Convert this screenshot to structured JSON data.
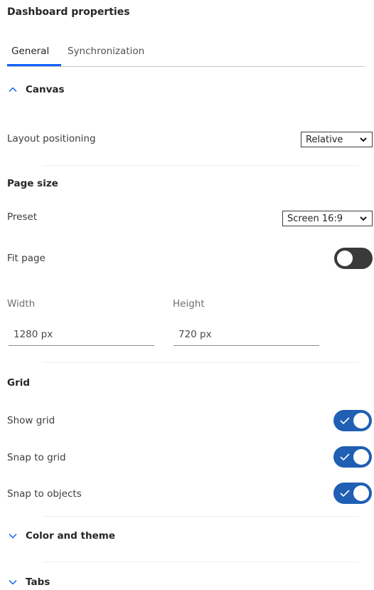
{
  "title": "Dashboard properties",
  "tabs": [
    {
      "label": "General",
      "active": true
    },
    {
      "label": "Synchronization",
      "active": false
    }
  ],
  "canvas": {
    "label": "Canvas",
    "expanded": true,
    "layout_positioning": {
      "label": "Layout positioning",
      "value": "Relative"
    },
    "page_size": {
      "heading": "Page size",
      "preset": {
        "label": "Preset",
        "value": "Screen 16:9"
      },
      "fit_page": {
        "label": "Fit page",
        "on": false
      },
      "width": {
        "label": "Width",
        "value": "1280 px"
      },
      "height": {
        "label": "Height",
        "value": "720 px"
      }
    },
    "grid": {
      "heading": "Grid",
      "show_grid": {
        "label": "Show grid",
        "on": true
      },
      "snap_to_grid": {
        "label": "Snap to grid",
        "on": true
      },
      "snap_to_objects": {
        "label": "Snap to objects",
        "on": true
      }
    }
  },
  "color_and_theme": {
    "label": "Color and theme",
    "expanded": false
  },
  "tabs_section": {
    "label": "Tabs",
    "expanded": false
  },
  "colors": {
    "accent": "#0f62fe",
    "toggle_on": "#1f5fb4",
    "toggle_off": "#3a3a3a"
  },
  "icons": {
    "expanded": "chevron-up-icon",
    "collapsed": "chevron-down-icon",
    "dropdown": "chevron-down-icon",
    "toggle_on": "checkmark-icon"
  }
}
